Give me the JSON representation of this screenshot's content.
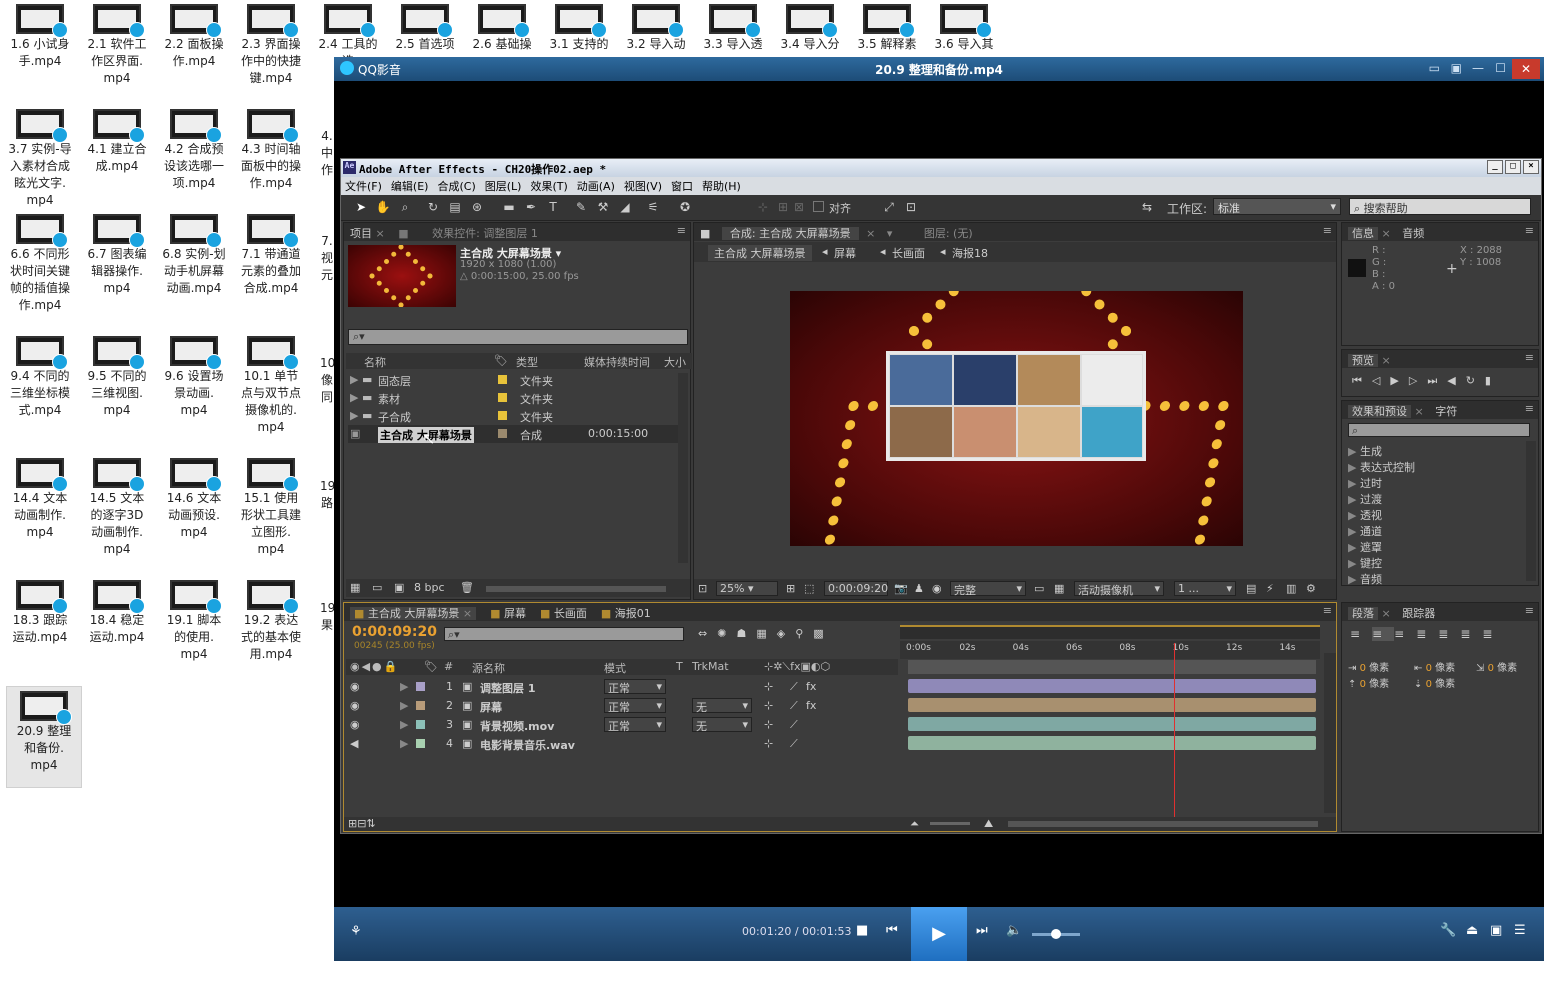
{
  "desktop": {
    "icons": [
      [
        "1.6 小试身",
        "手.mp4"
      ],
      [
        "2.1 软件工",
        "作区界面.",
        "mp4"
      ],
      [
        "2.2 面板操",
        "作.mp4"
      ],
      [
        "2.3 界面操",
        "作中的快捷",
        "键.mp4"
      ],
      [
        "2.4 工具的",
        "选"
      ],
      [
        "2.5 首选项"
      ],
      [
        "2.6 基础操"
      ],
      [
        "3.1 支持的"
      ],
      [
        "3.2 导入动"
      ],
      [
        "3.3 导入透"
      ],
      [
        "3.4 导入分"
      ],
      [
        "3.5 解释素"
      ],
      [
        "3.6 导入其"
      ],
      [
        "3.7 实例-导",
        "入素材合成",
        "眩光文字.",
        "mp4"
      ],
      [
        "4.1 建立合",
        "成.mp4"
      ],
      [
        "4.2 合成预",
        "设该选哪一",
        "项.mp4"
      ],
      [
        "4.3 时间轴",
        "面板中的操",
        "作.mp4"
      ],
      [
        "6.6 不同形",
        "状时间关键",
        "帧的插值操",
        "作.mp4"
      ],
      [
        "6.7 图表编",
        "辑器操作.",
        "mp4"
      ],
      [
        "6.8 实例-划",
        "动手机屏幕",
        "动画.mp4"
      ],
      [
        "7.1 带通道",
        "元素的叠加",
        "合成.mp4"
      ],
      [
        "9.4 不同的",
        "三维坐标模",
        "式.mp4"
      ],
      [
        "9.5 不同的",
        "三维视图.",
        "mp4"
      ],
      [
        "9.6 设置场",
        "景动画.",
        "mp4"
      ],
      [
        "10.1 单节",
        "点与双节点",
        "摄像机的.",
        "mp4"
      ],
      [
        "14.4 文本",
        "动画制作.",
        "mp4"
      ],
      [
        "14.5 文本",
        "的逐字3D",
        "动画制作.",
        "mp4"
      ],
      [
        "14.6 文本",
        "动画预设.",
        "mp4"
      ],
      [
        "15.1 使用",
        "形状工具建",
        "立图形.",
        "mp4"
      ],
      [
        "18.3  跟踪",
        "运动.mp4"
      ],
      [
        "18.4  稳定",
        "运动.mp4"
      ],
      [
        "19.1  脚本",
        "的使用.",
        "mp4"
      ],
      [
        "19.2  表达",
        "式的基本使",
        "用.mp4"
      ],
      [
        "20.9  整理",
        "和备份.",
        "mp4"
      ]
    ],
    "partial": [
      "4.",
      "中",
      "作",
      "7.",
      "视",
      "元",
      "10",
      "像",
      "同",
      "19",
      "路",
      "19",
      "果"
    ]
  },
  "player": {
    "app_name": "QQ影音",
    "file_title": "20.9   整理和备份.mp4",
    "time_current": "00:01:20",
    "time_total": "00:01:53",
    "time_display": "00:01:20 / 00:01:53",
    "progress": 0.71,
    "volume": 0.5
  },
  "ae": {
    "title": "Adobe After Effects - CH20操作02.aep *",
    "menu": [
      "文件(F)",
      "编辑(E)",
      "合成(C)",
      "图层(L)",
      "效果(T)",
      "动画(A)",
      "视图(V)",
      "窗口",
      "帮助(H)"
    ],
    "toolbar": {
      "align_label": "对齐",
      "workspace_label": "工作区:",
      "workspace_value": "标准",
      "search_placeholder": "搜索帮助"
    },
    "project": {
      "tab": "项目",
      "effects_tab": "效果控件: 调整图层 1",
      "comp_name": "主合成 大屏幕场景 ▾",
      "comp_size": "1920 x 1080 (1.00)",
      "comp_dur": "△ 0:00:15:00, 25.00 fps",
      "columns": [
        "名称",
        "类型",
        "媒体持续时间",
        "大小"
      ],
      "items": [
        {
          "name": "固态层",
          "type": "文件夹",
          "dur": "",
          "color": "#e8c33a"
        },
        {
          "name": "素材",
          "type": "文件夹",
          "dur": "",
          "color": "#e8c33a"
        },
        {
          "name": "子合成",
          "type": "文件夹",
          "dur": "",
          "color": "#e8c33a"
        },
        {
          "name": "主合成 大屏幕场景",
          "type": "合成",
          "dur": "0:00:15:00",
          "color": "#9b8a6e"
        }
      ],
      "bpc": "8 bpc"
    },
    "comp": {
      "tab": "合成: 主合成 大屏幕场景",
      "layer_tab": "图层: (无)",
      "breadcrumbs": [
        "主合成 大屏幕场景",
        "屏幕",
        "长画面",
        "海报18"
      ],
      "zoom": "25%",
      "timecode": "0:00:09:20",
      "quality": "完整",
      "camera": "活动摄像机",
      "views": "1 ..."
    },
    "info": {
      "tab": "信息",
      "audio_tab": "音频",
      "rgba": [
        "R :",
        "G :",
        "B :",
        "A : 0"
      ],
      "x": "X : 2088",
      "y": "Y : 1008"
    },
    "preview": {
      "tab": "预览"
    },
    "effects": {
      "tab": "效果和预设",
      "char_tab": "字符",
      "items": [
        "生成",
        "表达式控制",
        "过时",
        "过渡",
        "透视",
        "通道",
        "遮罩",
        "键控",
        "音频"
      ]
    },
    "paragraph": {
      "tab": "段落",
      "tracker_tab": "跟踪器",
      "unit": "像素",
      "value": "0"
    },
    "timeline": {
      "tabs": [
        "主合成 大屏幕场景",
        "屏幕",
        "长画面",
        "海报01"
      ],
      "timecode": "0:00:09:20",
      "frames": "00245 (25.00 fps)",
      "columns": {
        "name": "源名称",
        "mode": "模式",
        "t": "T",
        "trkmat": "TrkMat"
      },
      "ruler": [
        "0:00s",
        "02s",
        "04s",
        "06s",
        "08s",
        "10s",
        "12s",
        "14s"
      ],
      "playhead": 0.653,
      "layers": [
        {
          "num": "1",
          "name": "调整图层 1",
          "mode": "正常",
          "trk": "",
          "label": "#a9a0c8",
          "bar": "#8f89b8"
        },
        {
          "num": "2",
          "name": "屏幕",
          "mode": "正常",
          "trk": "无",
          "label": "#b89c7a",
          "bar": "#a8906f"
        },
        {
          "num": "3",
          "name": "背景视频.mov",
          "mode": "正常",
          "trk": "无",
          "label": "#8cc0b8",
          "bar": "#7fa8a3"
        },
        {
          "num": "4",
          "name": "电影背景音乐.wav",
          "mode": "",
          "trk": "",
          "label": "#a8d0b0",
          "bar": "#8fb29e"
        }
      ]
    }
  }
}
